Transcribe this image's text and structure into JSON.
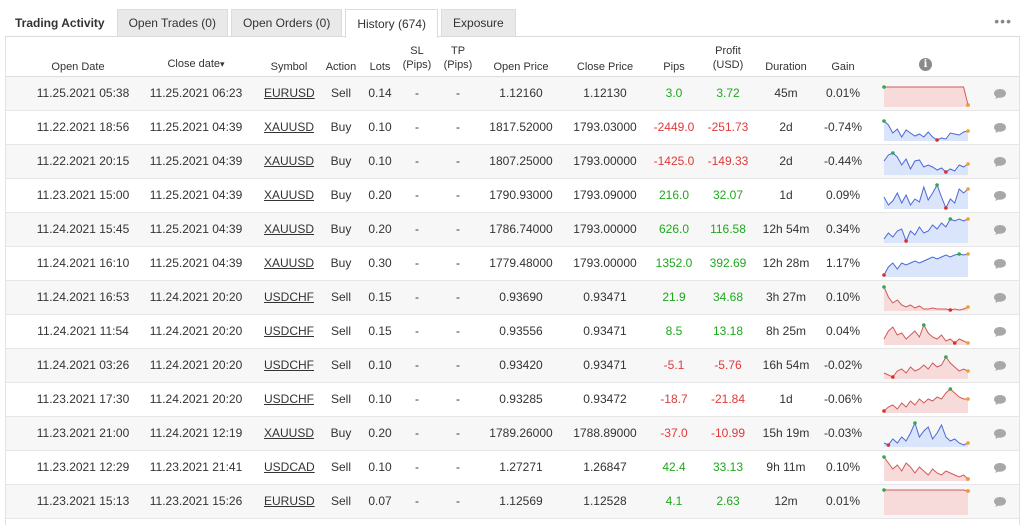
{
  "tabs": {
    "title": "Trading Activity",
    "items": [
      {
        "label": "Open Trades (0)",
        "active": false
      },
      {
        "label": "Open Orders (0)",
        "active": false
      },
      {
        "label": "History (674)",
        "active": true
      },
      {
        "label": "Exposure",
        "active": false
      }
    ],
    "more": "•••"
  },
  "headers": {
    "open_date": "Open Date",
    "close_date": "Close date",
    "sort_arrow": "▾",
    "symbol": "Symbol",
    "action": "Action",
    "lots": "Lots",
    "sl_1": "SL",
    "sl_2": "(Pips)",
    "tp_1": "TP",
    "tp_2": "(Pips)",
    "open_price": "Open Price",
    "close_price": "Close Price",
    "pips": "Pips",
    "profit_1": "Profit",
    "profit_2": "(USD)",
    "duration": "Duration",
    "gain": "Gain",
    "info_icon": "i"
  },
  "rows": [
    {
      "open_date": "11.25.2021 05:38",
      "close_date": "11.25.2021 06:23",
      "symbol": "EURUSD",
      "action": "Sell",
      "lots": "0.14",
      "sl": "-",
      "tp": "-",
      "open_price": "1.12160",
      "close_price": "1.12130",
      "pips": "3.0",
      "profit": "3.72",
      "duration": "45m",
      "gain": "0.01%",
      "sign": "pos",
      "spark": [
        8,
        8,
        8,
        8,
        8,
        8,
        8,
        8,
        8,
        8,
        8,
        8,
        8,
        8,
        8,
        8,
        8,
        8,
        8,
        26
      ],
      "fill": "#f7dbdb",
      "stroke": "#d05a5a"
    },
    {
      "open_date": "11.22.2021 18:56",
      "close_date": "11.25.2021 04:39",
      "symbol": "XAUUSD",
      "action": "Buy",
      "lots": "0.10",
      "sl": "-",
      "tp": "-",
      "open_price": "1817.52000",
      "close_price": "1793.03000",
      "pips": "-2449.0",
      "profit": "-251.73",
      "duration": "2d",
      "gain": "-0.74%",
      "sign": "neg",
      "spark": [
        8,
        12,
        20,
        16,
        24,
        17,
        20,
        23,
        21,
        24,
        19,
        24,
        27,
        25,
        26,
        20,
        21,
        22,
        19,
        18
      ],
      "fill": "#dae4fb",
      "stroke": "#4a69d6"
    },
    {
      "open_date": "11.22.2021 20:15",
      "close_date": "11.25.2021 04:39",
      "symbol": "XAUUSD",
      "action": "Buy",
      "lots": "0.10",
      "sl": "-",
      "tp": "-",
      "open_price": "1807.25000",
      "close_price": "1793.00000",
      "pips": "-1425.0",
      "profit": "-149.33",
      "duration": "2d",
      "gain": "-0.44%",
      "sign": "neg",
      "spark": [
        14,
        8,
        6,
        10,
        18,
        12,
        22,
        14,
        13,
        20,
        18,
        20,
        23,
        21,
        25,
        22,
        24,
        18,
        20,
        17
      ],
      "fill": "#dae4fb",
      "stroke": "#4a69d6"
    },
    {
      "open_date": "11.23.2021 15:00",
      "close_date": "11.25.2021 04:39",
      "symbol": "XAUUSD",
      "action": "Buy",
      "lots": "0.20",
      "sl": "-",
      "tp": "-",
      "open_price": "1790.93000",
      "close_price": "1793.09000",
      "pips": "216.0",
      "profit": "32.07",
      "duration": "1d",
      "gain": "0.09%",
      "sign": "pos",
      "spark": [
        16,
        24,
        20,
        12,
        22,
        14,
        24,
        18,
        21,
        6,
        19,
        12,
        4,
        16,
        27,
        18,
        22,
        8,
        12,
        8
      ],
      "fill": "#dae4fb",
      "stroke": "#4a69d6"
    },
    {
      "open_date": "11.24.2021 15:45",
      "close_date": "11.25.2021 04:39",
      "symbol": "XAUUSD",
      "action": "Buy",
      "lots": "0.20",
      "sl": "-",
      "tp": "-",
      "open_price": "1786.74000",
      "close_price": "1793.00000",
      "pips": "626.0",
      "profit": "116.58",
      "duration": "12h 54m",
      "gain": "0.34%",
      "sign": "pos",
      "spark": [
        24,
        18,
        22,
        16,
        14,
        26,
        16,
        20,
        12,
        18,
        16,
        10,
        14,
        8,
        12,
        4,
        6,
        4,
        6,
        4
      ],
      "fill": "#dae4fb",
      "stroke": "#4a69d6"
    },
    {
      "open_date": "11.24.2021 16:10",
      "close_date": "11.25.2021 04:39",
      "symbol": "XAUUSD",
      "action": "Buy",
      "lots": "0.30",
      "sl": "-",
      "tp": "-",
      "open_price": "1779.48000",
      "close_price": "1793.00000",
      "pips": "1352.0",
      "profit": "392.69",
      "duration": "12h 28m",
      "gain": "1.17%",
      "sign": "pos",
      "spark": [
        26,
        18,
        14,
        20,
        14,
        16,
        14,
        12,
        14,
        12,
        10,
        8,
        10,
        8,
        6,
        8,
        6,
        5,
        6,
        5
      ],
      "fill": "#dae4fb",
      "stroke": "#4a69d6"
    },
    {
      "open_date": "11.24.2021 16:53",
      "close_date": "11.24.2021 20:20",
      "symbol": "USDCHF",
      "action": "Sell",
      "lots": "0.15",
      "sl": "-",
      "tp": "-",
      "open_price": "0.93690",
      "close_price": "0.93471",
      "pips": "21.9",
      "profit": "34.68",
      "duration": "3h 27m",
      "gain": "0.10%",
      "sign": "pos",
      "spark": [
        4,
        14,
        20,
        17,
        22,
        24,
        22,
        25,
        23,
        26,
        26,
        25,
        26,
        26,
        26,
        27,
        26,
        27,
        26,
        24
      ],
      "fill": "#f7dbdb",
      "stroke": "#d05a5a"
    },
    {
      "open_date": "11.24.2021 11:54",
      "close_date": "11.24.2021 20:20",
      "symbol": "USDCHF",
      "action": "Sell",
      "lots": "0.15",
      "sl": "-",
      "tp": "-",
      "open_price": "0.93556",
      "close_price": "0.93471",
      "pips": "8.5",
      "profit": "13.18",
      "duration": "8h 25m",
      "gain": "0.04%",
      "sign": "pos",
      "spark": [
        22,
        14,
        10,
        18,
        16,
        22,
        18,
        14,
        20,
        8,
        16,
        20,
        22,
        18,
        24,
        22,
        26,
        22,
        24,
        26
      ],
      "fill": "#f7dbdb",
      "stroke": "#d05a5a"
    },
    {
      "open_date": "11.24.2021 03:26",
      "close_date": "11.24.2021 20:20",
      "symbol": "USDCHF",
      "action": "Sell",
      "lots": "0.10",
      "sl": "-",
      "tp": "-",
      "open_price": "0.93420",
      "close_price": "0.93471",
      "pips": "-5.1",
      "profit": "-5.76",
      "duration": "16h 54m",
      "gain": "-0.02%",
      "sign": "neg",
      "spark": [
        22,
        24,
        26,
        20,
        18,
        22,
        16,
        20,
        18,
        14,
        18,
        12,
        16,
        14,
        6,
        12,
        16,
        20,
        18,
        20
      ],
      "fill": "#f7dbdb",
      "stroke": "#d05a5a"
    },
    {
      "open_date": "11.23.2021 17:30",
      "close_date": "11.24.2021 20:20",
      "symbol": "USDCHF",
      "action": "Sell",
      "lots": "0.10",
      "sl": "-",
      "tp": "-",
      "open_price": "0.93285",
      "close_price": "0.93472",
      "pips": "-18.7",
      "profit": "-21.84",
      "duration": "1d",
      "gain": "-0.06%",
      "sign": "neg",
      "spark": [
        26,
        22,
        20,
        24,
        18,
        22,
        16,
        20,
        14,
        18,
        14,
        16,
        12,
        14,
        8,
        4,
        8,
        12,
        14,
        14
      ],
      "fill": "#f7dbdb",
      "stroke": "#d05a5a"
    },
    {
      "open_date": "11.23.2021 21:00",
      "close_date": "11.24.2021 12:19",
      "symbol": "XAUUSD",
      "action": "Buy",
      "lots": "0.20",
      "sl": "-",
      "tp": "-",
      "open_price": "1789.26000",
      "close_price": "1788.89000",
      "pips": "-37.0",
      "profit": "-10.99",
      "duration": "15h 19m",
      "gain": "-0.03%",
      "sign": "neg",
      "spark": [
        24,
        26,
        20,
        24,
        18,
        22,
        14,
        4,
        18,
        12,
        8,
        20,
        14,
        6,
        18,
        22,
        20,
        24,
        26,
        24
      ],
      "fill": "#dae4fb",
      "stroke": "#4a69d6"
    },
    {
      "open_date": "11.23.2021 12:29",
      "close_date": "11.23.2021 21:41",
      "symbol": "USDCAD",
      "action": "Sell",
      "lots": "0.10",
      "sl": "-",
      "tp": "-",
      "open_price": "1.27271",
      "close_price": "1.26847",
      "pips": "42.4",
      "profit": "33.13",
      "duration": "9h 11m",
      "gain": "0.10%",
      "sign": "pos",
      "spark": [
        4,
        10,
        16,
        12,
        18,
        10,
        14,
        20,
        14,
        18,
        22,
        16,
        20,
        22,
        18,
        20,
        22,
        24,
        22,
        26
      ],
      "fill": "#f7dbdb",
      "stroke": "#d05a5a"
    },
    {
      "open_date": "11.23.2021 15:13",
      "close_date": "11.23.2021 15:26",
      "symbol": "EURUSD",
      "action": "Sell",
      "lots": "0.07",
      "sl": "-",
      "tp": "-",
      "open_price": "1.12569",
      "close_price": "1.12528",
      "pips": "4.1",
      "profit": "2.63",
      "duration": "12m",
      "gain": "0.01%",
      "sign": "pos",
      "spark": [
        3,
        3,
        3,
        3,
        3,
        3,
        3,
        3,
        3,
        3,
        3,
        3,
        3,
        3,
        3,
        3,
        3,
        3,
        3,
        4
      ],
      "fill": "#f7dbdb",
      "stroke": "#d05a5a"
    }
  ],
  "icons": {
    "comment": "comment-icon",
    "info": "info-icon",
    "more": "more-dots-icon",
    "sort": "sort-desc-icon"
  },
  "colors": {
    "positive": "#1ea81e",
    "negative": "#e03a3a",
    "spark_max": "#2fa84f",
    "spark_min": "#e02b2b",
    "spark_last": "#f0a030"
  }
}
